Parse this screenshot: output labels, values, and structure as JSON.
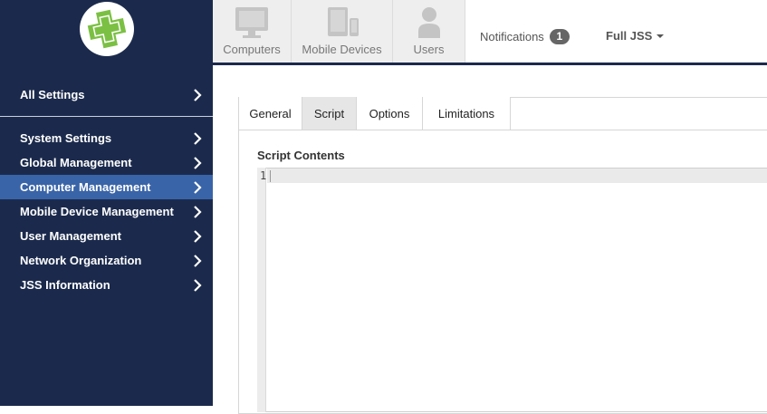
{
  "sidebar": {
    "top_item": "All Settings",
    "items": [
      {
        "label": "System Settings",
        "active": false
      },
      {
        "label": "Global Management",
        "active": false
      },
      {
        "label": "Computer Management",
        "active": true
      },
      {
        "label": "Mobile Device Management",
        "active": false
      },
      {
        "label": "User Management",
        "active": false
      },
      {
        "label": "Network Organization",
        "active": false
      },
      {
        "label": "JSS Information",
        "active": false
      }
    ],
    "logo_icon": "jamf-cross-logo-icon",
    "chevron_icon": "chevron-right-icon"
  },
  "topnav": {
    "tiles": [
      {
        "label": "Computers",
        "icon": "monitor-icon"
      },
      {
        "label": "Mobile Devices",
        "icon": "mobile-devices-icon"
      },
      {
        "label": "Users",
        "icon": "user-icon"
      }
    ],
    "notifications_label": "Notifications",
    "notifications_count": "1",
    "account_label": "Full JSS"
  },
  "tabs": [
    {
      "label": "General",
      "active": false
    },
    {
      "label": "Script",
      "active": true
    },
    {
      "label": "Options",
      "active": false
    },
    {
      "label": "Limitations",
      "active": false
    }
  ],
  "editor": {
    "section_label": "Script Contents",
    "line_number": "1",
    "content": ""
  },
  "colors": {
    "sidebar_bg": "#1b2a4c",
    "sidebar_active": "#3a64a8",
    "logo_green": "#7bc043"
  }
}
